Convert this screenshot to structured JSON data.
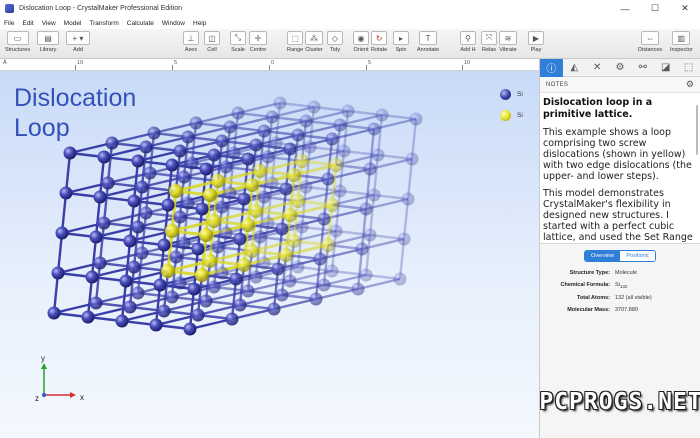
{
  "window": {
    "title": "Dislocation Loop - CrystalMaker Professional Edition",
    "min_glyph": "—",
    "max_glyph": "☐",
    "close_glyph": "✕"
  },
  "menu": [
    "File",
    "Edit",
    "View",
    "Model",
    "Transform",
    "Calculate",
    "Window",
    "Help"
  ],
  "toolbar": {
    "structures": "Structures",
    "library": "Library",
    "add": "Add",
    "axes": "Axes",
    "cell": "Cell",
    "scale": "Scale",
    "centre": "Centre",
    "range": "Range",
    "cluster": "Cluster",
    "tidy": "Tidy",
    "orient": "Orient",
    "rotate": "Rotate",
    "spin": "Spin",
    "annotate": "Annotate",
    "add_h": "Add H",
    "relax": "Relax",
    "vibrate": "Vibrate",
    "play": "Play",
    "distances": "Distances",
    "inspector": "Inspector"
  },
  "ruler": {
    "labels": [
      "Å",
      "10",
      "5",
      "0",
      "5",
      "10"
    ]
  },
  "viewport": {
    "model_title": "Dislocation Loop",
    "legend": [
      {
        "label": "Si",
        "color": "#3a3fa8"
      },
      {
        "label": "Si",
        "color": "#e4e022"
      }
    ],
    "axis_labels": {
      "y": "y",
      "z": "z",
      "x": "x"
    }
  },
  "panel": {
    "notes_label": "NOTES",
    "heading": "Dislocation loop in a primitive lattice.",
    "paragraphs": [
      "This example shows a loop comprising two screw dislocations (shown in yellow) with two edge dislocations (the upper- and lower steps).",
      "This model demonstrates CrystalMaker's flexibility in designed new structures. I started with a perfect cubic lattice, and used the Set Range command to"
    ],
    "tabs": {
      "overview": "Overview",
      "positions": "Positions"
    },
    "info": {
      "structure_type_key": "Structure Type:",
      "structure_type": "Molecule",
      "formula_key": "Chemical Formula:",
      "formula_base": "Si",
      "formula_sub": "132",
      "atoms_key": "Total Atoms:",
      "atoms": "132 (all visible)",
      "mass_key": "Molecular Mass:",
      "mass": "3707.880"
    }
  },
  "watermark": "PCPROGS.NET",
  "colors": {
    "accent": "#2f7fd8",
    "atom_blue": "#3a3fa8",
    "atom_yellow": "#e4e022",
    "title_blue": "#3550b8"
  }
}
